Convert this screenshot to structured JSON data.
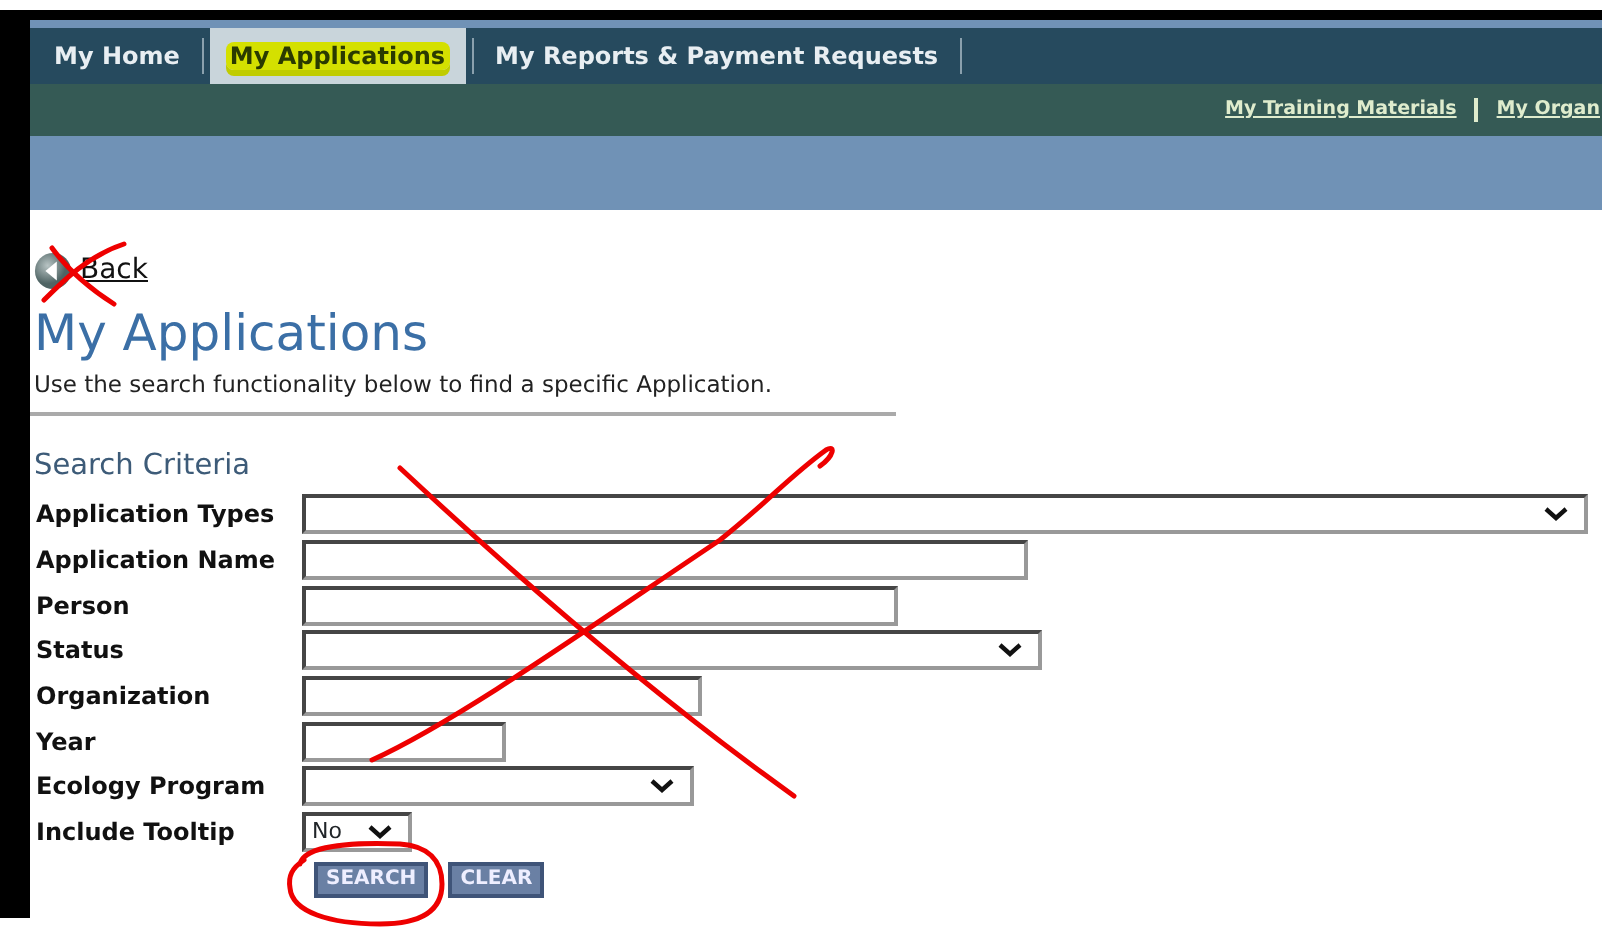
{
  "nav_tabs": [
    {
      "label": "My Home",
      "selected": false,
      "highlighted": false
    },
    {
      "label": "My Applications",
      "selected": true,
      "highlighted": true
    },
    {
      "label": "My Reports & Payment Requests",
      "selected": false,
      "highlighted": false
    }
  ],
  "sub_links": [
    "My Training Materials",
    "My Organ"
  ],
  "back_link": "Back",
  "page_title": "My Applications",
  "intro": "Use the search functionality below to find a specific Application.",
  "search_heading": "Search Criteria",
  "fields": [
    {
      "label": "Application Types",
      "kind": "select"
    },
    {
      "label": "Application Name",
      "kind": "text"
    },
    {
      "label": "Person",
      "kind": "text"
    },
    {
      "label": "Status",
      "kind": "select"
    },
    {
      "label": "Organization",
      "kind": "text"
    },
    {
      "label": "Year",
      "kind": "text"
    },
    {
      "label": "Ecology Program",
      "kind": "select"
    },
    {
      "label": "Include Tooltip",
      "kind": "select",
      "value": "No"
    }
  ],
  "buttons": [
    "SEARCH",
    "CLEAR"
  ]
}
